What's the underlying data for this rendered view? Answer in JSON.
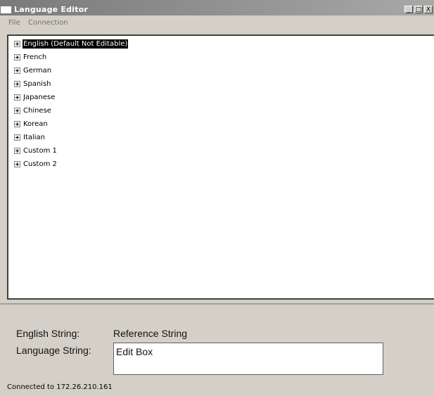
{
  "window": {
    "title": "Language Editor",
    "controls": {
      "minimize": "_",
      "maximize": "□",
      "close": "X"
    }
  },
  "menu": [
    "File",
    "Connection"
  ],
  "tree": {
    "items": [
      {
        "label": "English (Default Not Editable)",
        "selected": true
      },
      {
        "label": "French"
      },
      {
        "label": "German"
      },
      {
        "label": "Spanish"
      },
      {
        "label": "Japanese"
      },
      {
        "label": "Chinese"
      },
      {
        "label": "Korean"
      },
      {
        "label": "Italian"
      },
      {
        "label": "Custom 1"
      },
      {
        "label": "Custom 2"
      }
    ]
  },
  "editor": {
    "english_label": "English String:",
    "english_value": "Reference String",
    "language_label": "Language String:",
    "language_value": "Edit Box"
  },
  "status": "Connected to 172.26.210.161",
  "colors": {
    "titlebar": "#8a8a8a",
    "window_bg": "#d4d0c8",
    "selection": "#000000"
  }
}
